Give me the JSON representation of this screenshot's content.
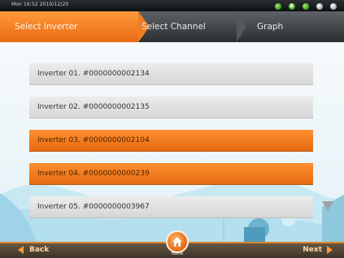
{
  "status": {
    "time": "Mon 16:52 2010/12/20"
  },
  "steps": [
    "Select Inverter",
    "Select Channel",
    "Graph"
  ],
  "inverters": [
    "Inverter 01. #0000000002134",
    "Inverter 02. #0000000002135",
    "Inverter 03. #0000000002104",
    "Inverter 04. #0000000000239",
    "Inverter 05. #0000000003967"
  ],
  "selected_indices": [
    2,
    3
  ],
  "bottom": {
    "back": "Back",
    "next": "Next",
    "home_label": "Home"
  },
  "colors": {
    "accent": "#ef7d22",
    "row": "#dcdcdc",
    "bar": "#2b2e31"
  }
}
